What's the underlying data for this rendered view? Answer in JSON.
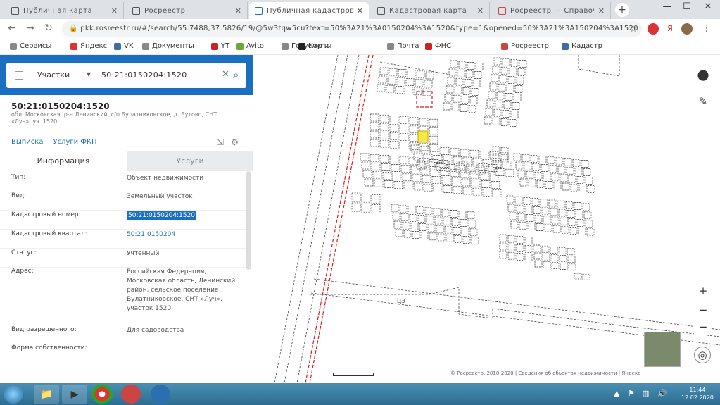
{
  "browser": {
    "tabs": [
      {
        "title": "Публичная карта",
        "active": false
      },
      {
        "title": "Росреестр",
        "active": false
      },
      {
        "title": "Публичная кадастровая",
        "active": true
      },
      {
        "title": "Кадастровая карта",
        "active": false
      },
      {
        "title": "Росреестр — Справочная",
        "active": false
      }
    ],
    "new_tab": "+",
    "window_controls": {
      "minimize": "—",
      "maximize": "☐",
      "close": "✕"
    },
    "address": "pkk.rosreestr.ru/#/search/55.7488,37.5826/19/@5w3tqw5cu?text=50%3A21%3A0150204%3A1520&type=1&opened=50%3A21%3A150204%3A1520",
    "bookmarks": [
      "Сервисы",
      "Яндекс",
      "VK",
      "Документы",
      "YT",
      "Avito",
      "Госуслуги",
      "Карты",
      "Почта",
      "ФНС",
      "Росреестр",
      "Кадастр"
    ]
  },
  "search": {
    "type_label": "Участки",
    "caret": "▾",
    "query": "50:21:0150204:1520",
    "clear": "✕",
    "search_icon": "⌕"
  },
  "object": {
    "title": "50:21:0150204:1520",
    "subtitle": "обл. Московская, р-н Ленинский, с/п Булатниковское, д. Бутово, СНТ «Луч», уч. 1520",
    "links": [
      "Выписка",
      "Услуги ФКП"
    ],
    "tabs": [
      "Информация",
      "Услуги"
    ]
  },
  "info_rows": [
    {
      "key": "Тип:",
      "value": "Объект недвижимости"
    },
    {
      "key": "Вид:",
      "value": "Земельный участок"
    },
    {
      "key": "Кадастровый номер:",
      "value": "50:21:0150204:1520"
    },
    {
      "key": "Кадастровый квартал:",
      "value": "50:21:0150204"
    },
    {
      "key": "Статус:",
      "value": "Учтенный"
    },
    {
      "key": "Адрес:",
      "value": "Российская Федерация, Московская область, Ленинский район, сельское поселение Булатниковское, СНТ «Луч», участок 1520"
    },
    {
      "key": "Вид разрешенного:",
      "value": "Для садоводства"
    },
    {
      "key": "Форма собственности:",
      "value": ""
    }
  ],
  "map": {
    "controls": [
      "+",
      "−",
      "−"
    ],
    "side_tools": [
      "pin-icon",
      "pencil-icon"
    ],
    "locate": "◎",
    "scale": "",
    "attribution": "© Росреестр, 2010-2020 | Сведения об обьектах недвижимости | Яндекс"
  },
  "taskbar": {
    "clock_time": "11:44",
    "clock_date": "12.02.2020",
    "tray": [
      "▲",
      "⚑",
      "▥",
      "🔊"
    ]
  },
  "colors": {
    "accent": "#1b6fc0",
    "selected_parcel": "#f5e94a",
    "boundary_red": "#d02020"
  }
}
